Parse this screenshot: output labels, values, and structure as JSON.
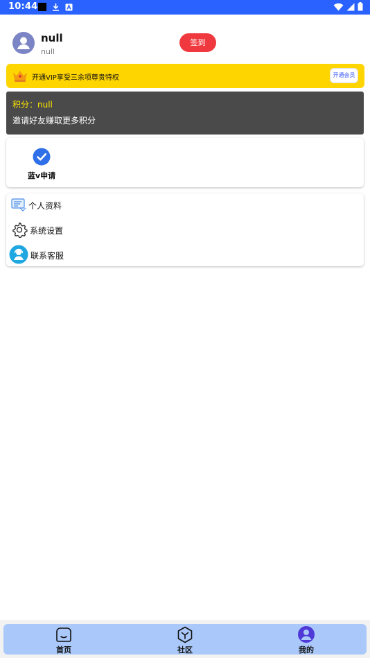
{
  "status": {
    "time": "10:44"
  },
  "profile": {
    "name": "null",
    "sub": "null",
    "signin_label": "签到"
  },
  "vip": {
    "text": "开通VIP享受三余项尊贵特权",
    "button": "开通会员"
  },
  "points": {
    "label": "积分：null",
    "sub": "邀请好友赚取更多积分"
  },
  "features": [
    {
      "label": "蓝v申请",
      "icon": "check-badge-icon"
    }
  ],
  "menu": [
    {
      "label": "个人资料",
      "icon": "profile-card-icon"
    },
    {
      "label": "系统设置",
      "icon": "gear-icon"
    },
    {
      "label": "联系客服",
      "icon": "customer-service-icon"
    }
  ],
  "tabs": [
    {
      "label": "首页",
      "icon": "home-icon",
      "active": false
    },
    {
      "label": "社区",
      "icon": "community-icon",
      "active": false
    },
    {
      "label": "我的",
      "icon": "user-icon",
      "active": true
    }
  ],
  "colors": {
    "status_bar": "#2962ff",
    "signin": "#f0393e",
    "vip": "#ffd500",
    "points_bg": "#4a4a4a",
    "points_label": "#ffe800",
    "tabbar": "#aac9fa",
    "accent": "#2f6fe8"
  }
}
